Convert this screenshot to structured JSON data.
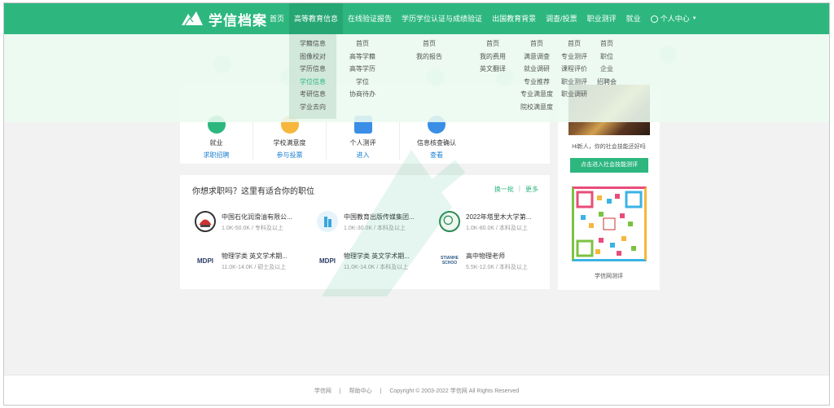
{
  "header": {
    "logo_text": "学信档案",
    "nav": [
      {
        "label": "首页"
      },
      {
        "label": "高等教育信息"
      },
      {
        "label": "在线验证报告"
      },
      {
        "label": "学历学位认证与成绩验证"
      },
      {
        "label": "出国教育背景"
      },
      {
        "label": "调查/投票"
      },
      {
        "label": "职业测评"
      },
      {
        "label": "就业"
      },
      {
        "label": "个人中心"
      }
    ]
  },
  "mega_menu": {
    "col1": [
      "学籍信息",
      "图像校对",
      "学历信息",
      "学位信息",
      "考研信息",
      "学业去向"
    ],
    "col2": [
      "首页",
      "高等学籍",
      "高等学历",
      "学位",
      "协商待办"
    ],
    "col3": [
      "首页",
      "我的报告"
    ],
    "col4": [
      "首页",
      "我的费用",
      "英文翻译"
    ],
    "col5": [
      "首页",
      "满意调查",
      "就业调研",
      "专业推荐",
      "专业满意度",
      "院校满意度"
    ],
    "col6": [
      "首页",
      "专业测评",
      "课程评价",
      "职业测评",
      "职业调研"
    ],
    "col7": [
      "首页",
      "职位",
      "企业",
      "招聘会"
    ]
  },
  "services": [
    {
      "title": "就业",
      "link": "求职招聘",
      "icon": "briefcase-icon",
      "color": "#2db77f"
    },
    {
      "title": "学校满意度",
      "link": "参与投票",
      "icon": "smile-icon",
      "color": "#f6b73c"
    },
    {
      "title": "个人测评",
      "link": "进入",
      "icon": "check-icon",
      "color": "#3a8ee6"
    },
    {
      "title": "信息核查确认",
      "link": "查看",
      "icon": "shield-icon",
      "color": "#3a8ee6"
    }
  ],
  "jobs": {
    "heading": "你想求职吗？这里有适合你的职位",
    "refresh": "换一批",
    "separator": "|",
    "more": "更多",
    "items": [
      {
        "title": "中国石化润滑油有限公...",
        "meta": "1.0K-50.0K / 专科及以上",
        "logo": "sinopec-logo"
      },
      {
        "title": "中国教育出版传媒集团...",
        "meta": "1.0K-30.0K / 本科及以上",
        "logo": "building-logo"
      },
      {
        "title": "2022年塔里木大学第...",
        "meta": "1.0K-80.0K / 本科及以上",
        "logo": "university-seal-logo"
      },
      {
        "title": "物理学类 英文学术期...",
        "meta": "11.0K-14.0K / 硕士及以上",
        "logo": "MDPI"
      },
      {
        "title": "物理学类 英文学术期...",
        "meta": "11.0K-14.0K / 本科及以上",
        "logo": "MDPI"
      },
      {
        "title": "高中物理老师",
        "meta": "5.5K-12.0K / 本科及以上",
        "logo": "STIANHE SCHOO"
      }
    ]
  },
  "side": {
    "tagline": "Hi新人，你的社会技能还好吗",
    "button": "点击进入社会技能测评",
    "qr_caption": "学信网测评"
  },
  "footer": {
    "link1": "学信网",
    "sep": "|",
    "link2": "帮助中心",
    "copyright": "Copyright © 2003-2022 学信网 All Rights Reserved"
  },
  "colors": {
    "brand": "#2db77f",
    "link": "#1a7fd1"
  }
}
